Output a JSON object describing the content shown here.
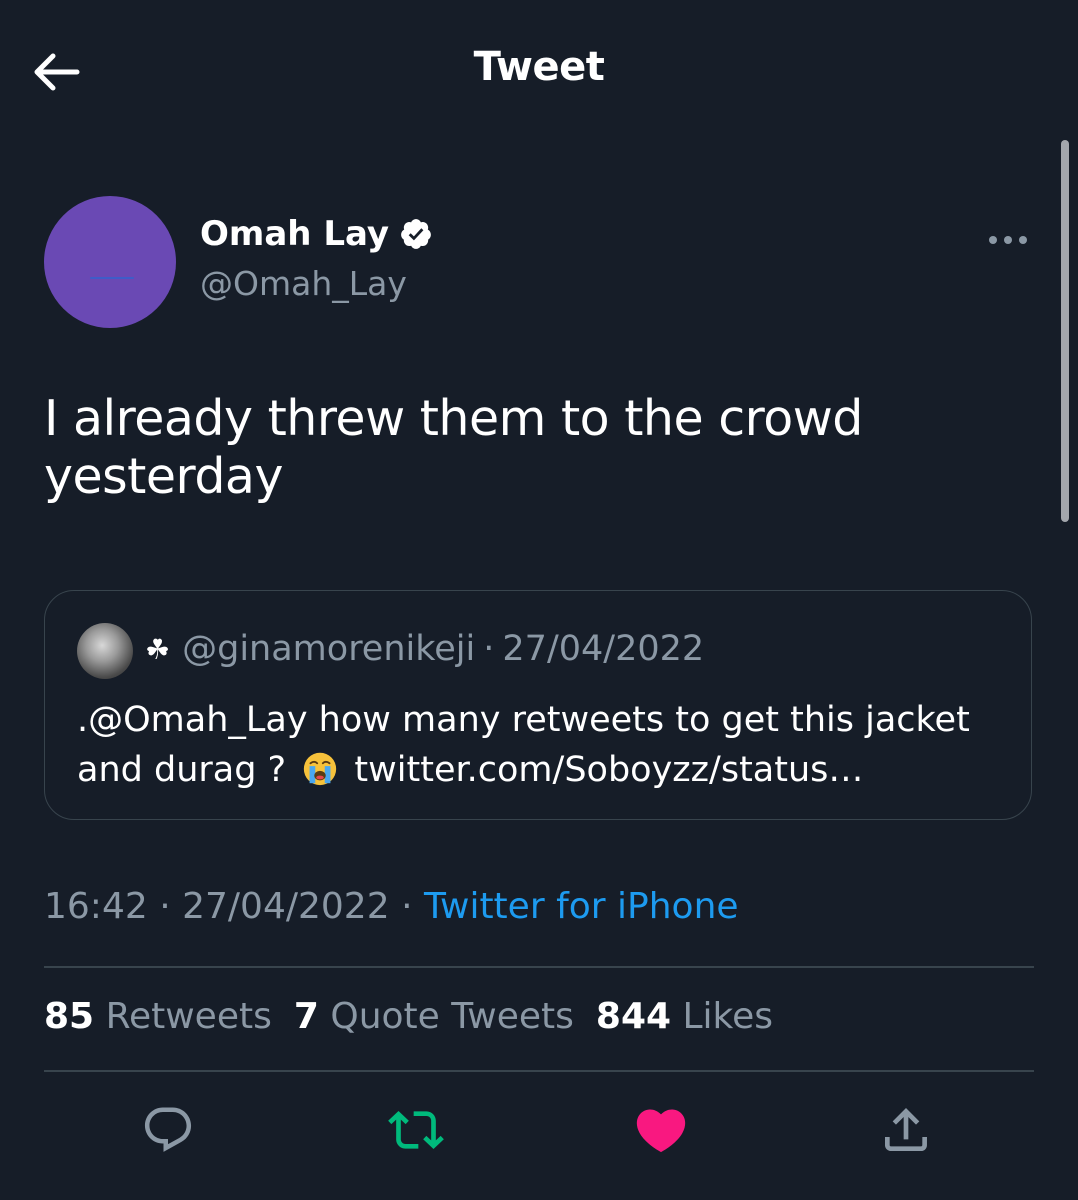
{
  "header": {
    "title": "Tweet",
    "back_icon": "back-arrow-icon"
  },
  "tweet": {
    "author": {
      "display_name": "Omah Lay",
      "handle": "@Omah_Lay",
      "verified": true,
      "avatar_color": "#6a49b4"
    },
    "text": "I already threw them to the crowd yesterday",
    "quoted": {
      "name_glyph": "☘",
      "handle": "@ginamorenikeji",
      "date": "27/04/2022",
      "text_before_emoji": ".@Omah_Lay how many retweets to get this jacket and durag ?",
      "emoji": "loudly-crying-face",
      "link": "twitter.com/Soboyzz/status…"
    },
    "time": "16:42",
    "date": "27/04/2022",
    "source": "Twitter for iPhone",
    "separator": "·"
  },
  "stats": {
    "retweets_count": "85",
    "retweets_label": "Retweets",
    "quotes_count": "7",
    "quotes_label": "Quote Tweets",
    "likes_count": "844",
    "likes_label": "Likes"
  },
  "actions": {
    "reply_icon": "reply-icon",
    "retweet_icon": "retweet-icon",
    "like_icon": "heart-icon",
    "share_icon": "share-icon",
    "retweet_color": "#00ba7c",
    "like_color": "#f91880"
  },
  "colors": {
    "background": "#161d28",
    "text_primary": "#ffffff",
    "text_secondary": "#8b98a5",
    "accent": "#1d9bf0",
    "border": "#38444d"
  }
}
